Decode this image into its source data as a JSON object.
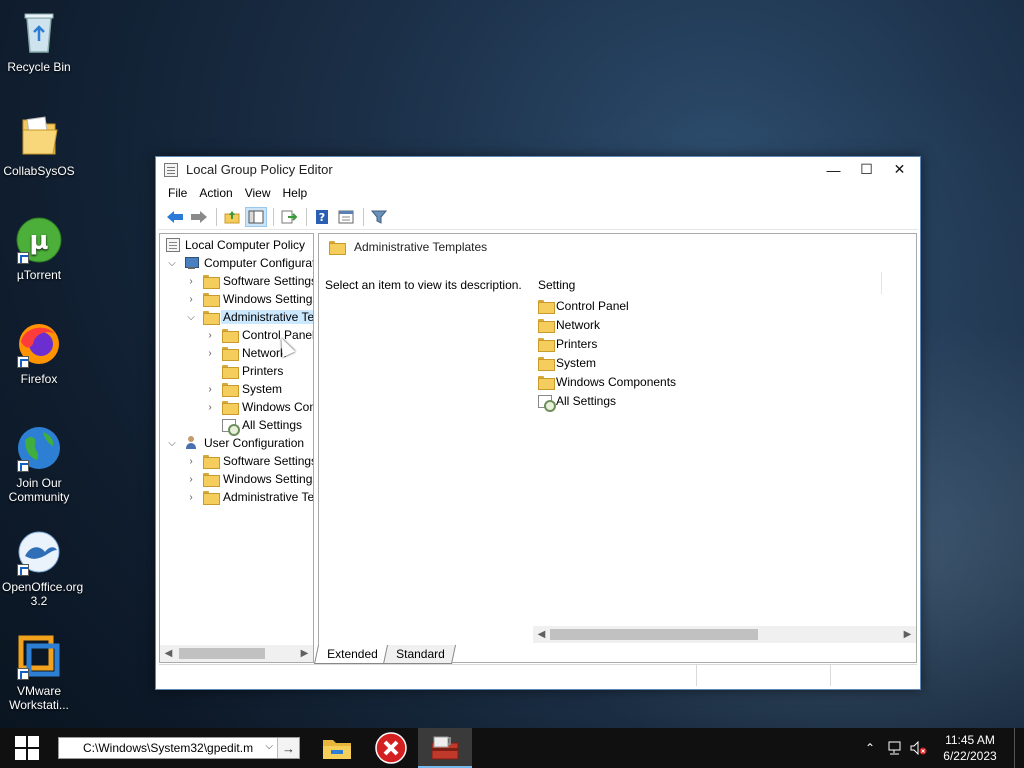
{
  "desktop": {
    "icons": [
      {
        "label": "Recycle Bin",
        "icon": "recycle-bin-icon"
      },
      {
        "label": "CollabSysOS",
        "icon": "folder-icon"
      },
      {
        "label": "µTorrent",
        "icon": "utorrent-icon"
      },
      {
        "label": "Firefox",
        "icon": "firefox-icon"
      },
      {
        "label": "Join Our Community",
        "icon": "globe-icon"
      },
      {
        "label": "OpenOffice.org 3.2",
        "icon": "openoffice-icon"
      },
      {
        "label": "VMware Workstati...",
        "icon": "vmware-icon"
      }
    ]
  },
  "window": {
    "title": "Local Group Policy Editor",
    "controls": {
      "minimize": "—",
      "maximize": "☐",
      "close": "✕"
    },
    "menu": [
      "File",
      "Action",
      "Help",
      "View"
    ],
    "menu_ordered": [
      "File",
      "Action",
      "View",
      "Help"
    ],
    "tree": {
      "root": "Local Computer Policy",
      "computer_config": "Computer Configuration",
      "cc_software": "Software Settings",
      "cc_windows": "Windows Settings",
      "cc_admin": "Administrative Templates",
      "at_control_panel": "Control Panel",
      "at_network": "Network",
      "at_printers": "Printers",
      "at_system": "System",
      "at_windows_components": "Windows Components",
      "at_all_settings": "All Settings",
      "user_config": "User Configuration",
      "uc_software": "Software Settings",
      "uc_windows": "Windows Settings",
      "uc_admin": "Administrative Templates"
    },
    "right_pane": {
      "header": "Administrative Templates",
      "description": "Select an item to view its description.",
      "column_header": "Setting",
      "items": [
        "Control Panel",
        "Network",
        "Printers",
        "System",
        "Windows Components",
        "All Settings"
      ]
    },
    "tabs": {
      "extended": "Extended",
      "standard": "Standard"
    }
  },
  "taskbar": {
    "run_value": "C:\\Windows\\System32\\gpedit.m",
    "time": "11:45 AM",
    "date": "6/22/2023"
  }
}
